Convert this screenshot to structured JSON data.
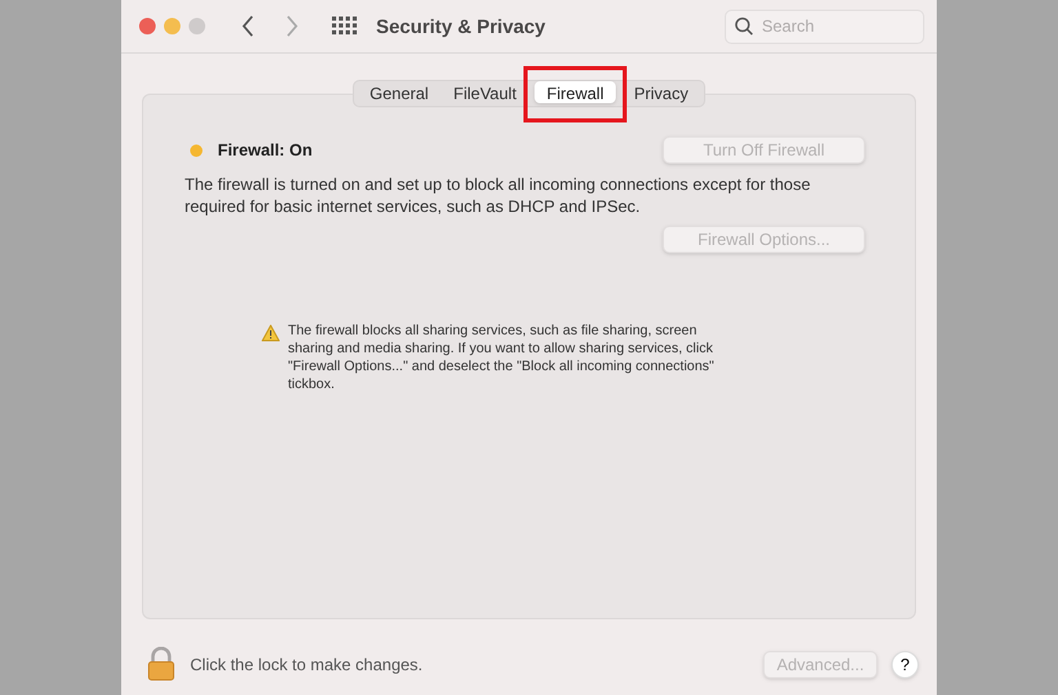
{
  "window": {
    "title": "Security & Privacy",
    "search": {
      "placeholder": "Search"
    }
  },
  "tabs": [
    {
      "label": "General",
      "selected": false,
      "highlighted": false
    },
    {
      "label": "FileVault",
      "selected": false,
      "highlighted": false
    },
    {
      "label": "Firewall",
      "selected": true,
      "highlighted": true
    },
    {
      "label": "Privacy",
      "selected": false,
      "highlighted": false
    }
  ],
  "firewall": {
    "status": "Firewall: On",
    "color": "#f5b731",
    "toggle_button": {
      "label": "Turn Off Firewall",
      "disabled": true
    },
    "description": "The firewall is turned on and set up to block all incoming connections except for those required for basic internet services, such as DHCP and IPSec.",
    "options_button": {
      "label": "Firewall Options...",
      "disabled": true
    },
    "warning": "The firewall blocks all sharing services, such as file sharing, screen sharing and media sharing. If you want to allow sharing services, click \"Firewall Options...\" and deselect the \"Block all incoming connections\" tickbox."
  },
  "footer": {
    "lock_text": "Click the lock to make changes.",
    "advanced_button": {
      "label": "Advanced...",
      "disabled": true
    },
    "help_button": "?"
  }
}
